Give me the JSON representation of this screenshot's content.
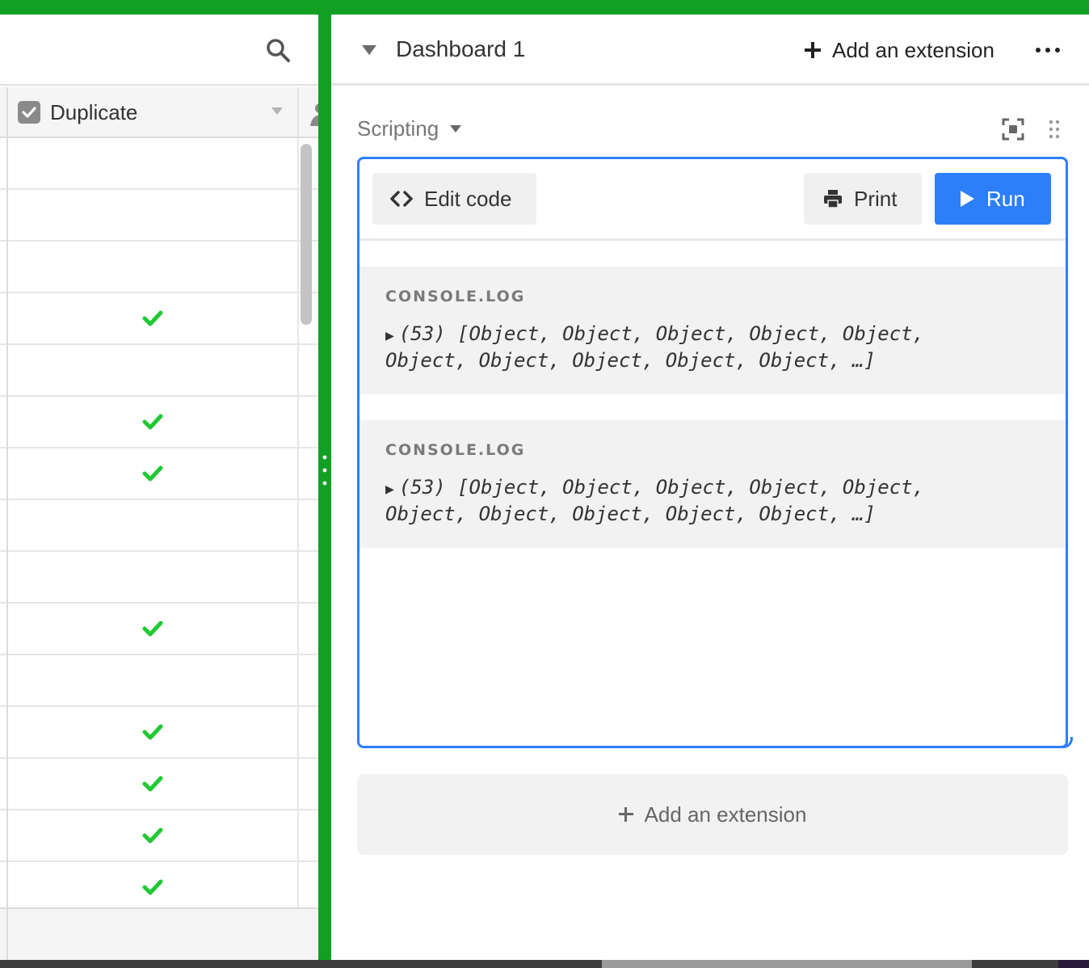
{
  "colors": {
    "accent_green": "#11a024",
    "accent_blue": "#2d7ff9",
    "check_green": "#20c933"
  },
  "grid": {
    "search_icon": "search-icon",
    "column": {
      "title": "Duplicate",
      "type_icon": "checkbox-field-icon"
    },
    "rows": [
      {
        "checked": false
      },
      {
        "checked": false
      },
      {
        "checked": false
      },
      {
        "checked": true
      },
      {
        "checked": false
      },
      {
        "checked": true
      },
      {
        "checked": true
      },
      {
        "checked": false
      },
      {
        "checked": false
      },
      {
        "checked": true
      },
      {
        "checked": false
      },
      {
        "checked": true
      },
      {
        "checked": true
      },
      {
        "checked": true
      },
      {
        "checked": true
      }
    ]
  },
  "dashboard": {
    "title": "Dashboard 1",
    "add_extension_label": "Add an extension",
    "more_icon": "more-horizontal-icon",
    "extension": {
      "name": "Scripting",
      "edit_code_label": "Edit code",
      "print_label": "Print",
      "run_label": "Run",
      "console": [
        {
          "label": "CONSOLE.LOG",
          "text": "(53) [Object, Object, Object, Object, Object, Object, Object, Object, Object, Object, …]"
        },
        {
          "label": "CONSOLE.LOG",
          "text": "(53) [Object, Object, Object, Object, Object, Object, Object, Object, Object, Object, …]"
        }
      ]
    },
    "add_extension_bottom_label": "Add an extension"
  }
}
